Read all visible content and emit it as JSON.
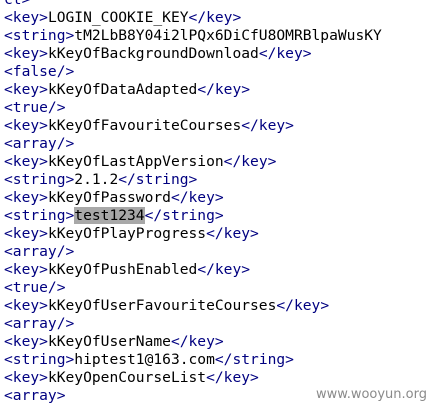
{
  "lines": [
    {
      "parts": [
        {
          "t": "ct>",
          "c": "tag"
        }
      ]
    },
    {
      "parts": [
        {
          "t": "<key>",
          "c": "tag"
        },
        {
          "t": "LOGIN_COOKIE_KEY",
          "c": "text"
        },
        {
          "t": "</key>",
          "c": "tag"
        }
      ]
    },
    {
      "parts": [
        {
          "t": "<string>",
          "c": "tag"
        },
        {
          "t": "tM2LbB8Y04i2lPQx6DiCfU8OMRBlpaWusKY",
          "c": "text"
        }
      ]
    },
    {
      "parts": [
        {
          "t": "<key>",
          "c": "tag"
        },
        {
          "t": "kKeyOfBackgroundDownload",
          "c": "text"
        },
        {
          "t": "</key>",
          "c": "tag"
        }
      ]
    },
    {
      "parts": [
        {
          "t": "<false/>",
          "c": "tag"
        }
      ]
    },
    {
      "parts": [
        {
          "t": "<key>",
          "c": "tag"
        },
        {
          "t": "kKeyOfDataAdapted",
          "c": "text"
        },
        {
          "t": "</key>",
          "c": "tag"
        }
      ]
    },
    {
      "parts": [
        {
          "t": "<true/>",
          "c": "tag"
        }
      ]
    },
    {
      "parts": [
        {
          "t": "<key>",
          "c": "tag"
        },
        {
          "t": "kKeyOfFavouriteCourses",
          "c": "text"
        },
        {
          "t": "</key>",
          "c": "tag"
        }
      ]
    },
    {
      "parts": [
        {
          "t": "<array/>",
          "c": "tag"
        }
      ]
    },
    {
      "parts": [
        {
          "t": "<key>",
          "c": "tag"
        },
        {
          "t": "kKeyOfLastAppVersion",
          "c": "text"
        },
        {
          "t": "</key>",
          "c": "tag"
        }
      ]
    },
    {
      "parts": [
        {
          "t": "<string>",
          "c": "tag"
        },
        {
          "t": "2.1.2",
          "c": "text"
        },
        {
          "t": "</string>",
          "c": "tag"
        }
      ]
    },
    {
      "parts": [
        {
          "t": "<key>",
          "c": "tag"
        },
        {
          "t": "kKeyOfPassword",
          "c": "text"
        },
        {
          "t": "</key>",
          "c": "tag"
        }
      ]
    },
    {
      "parts": [
        {
          "t": "<string>",
          "c": "tag"
        },
        {
          "t": "test1234",
          "c": "text",
          "hl": true
        },
        {
          "t": "</string>",
          "c": "tag"
        }
      ]
    },
    {
      "parts": [
        {
          "t": "<key>",
          "c": "tag"
        },
        {
          "t": "kKeyOfPlayProgress",
          "c": "text"
        },
        {
          "t": "</key>",
          "c": "tag"
        }
      ]
    },
    {
      "parts": [
        {
          "t": "<array/>",
          "c": "tag"
        }
      ]
    },
    {
      "parts": [
        {
          "t": "<key>",
          "c": "tag"
        },
        {
          "t": "kKeyOfPushEnabled",
          "c": "text"
        },
        {
          "t": "</key>",
          "c": "tag"
        }
      ]
    },
    {
      "parts": [
        {
          "t": "<true/>",
          "c": "tag"
        }
      ]
    },
    {
      "parts": [
        {
          "t": "<key>",
          "c": "tag"
        },
        {
          "t": "kKeyOfUserFavouriteCourses",
          "c": "text"
        },
        {
          "t": "</key>",
          "c": "tag"
        }
      ]
    },
    {
      "parts": [
        {
          "t": "<array/>",
          "c": "tag"
        }
      ]
    },
    {
      "parts": [
        {
          "t": "<key>",
          "c": "tag"
        },
        {
          "t": "kKeyOfUserName",
          "c": "text"
        },
        {
          "t": "</key>",
          "c": "tag"
        }
      ]
    },
    {
      "parts": [
        {
          "t": "<string>",
          "c": "tag"
        },
        {
          "t": "hiptest1@163.com",
          "c": "text"
        },
        {
          "t": "</string>",
          "c": "tag"
        }
      ]
    },
    {
      "parts": [
        {
          "t": "<key>",
          "c": "tag"
        },
        {
          "t": "kKeyOpenCourseList",
          "c": "text"
        },
        {
          "t": "</key>",
          "c": "tag"
        }
      ]
    },
    {
      "parts": [
        {
          "t": "<array>",
          "c": "tag"
        }
      ]
    }
  ],
  "watermark": "www.wooyun.org"
}
